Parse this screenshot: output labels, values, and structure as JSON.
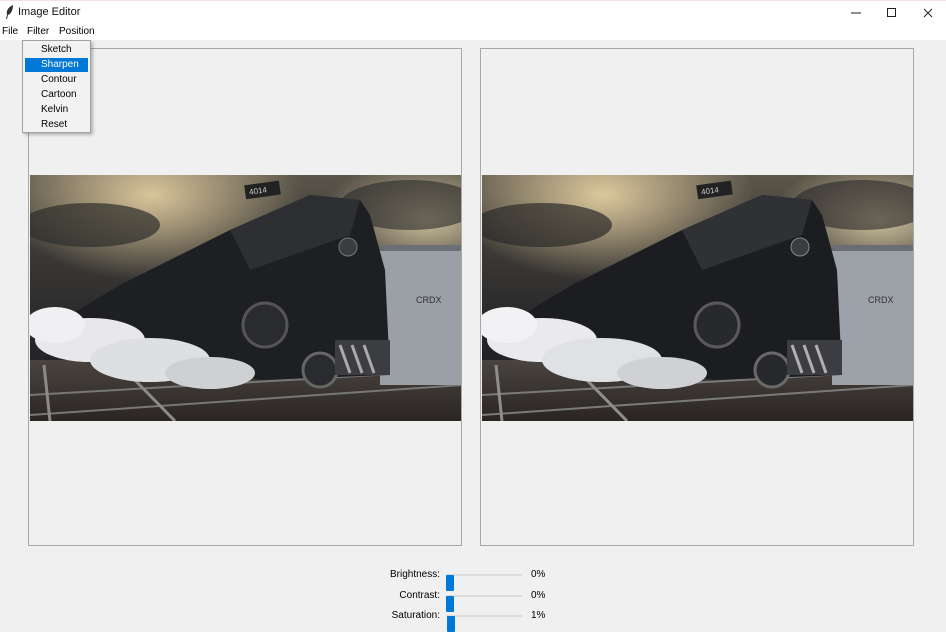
{
  "window": {
    "title": "Image Editor",
    "controls": {
      "minimize_icon": "minimize-icon",
      "maximize_icon": "maximize-icon",
      "close_icon": "close-icon"
    }
  },
  "menubar": {
    "items": [
      {
        "label": "File"
      },
      {
        "label": "Filter"
      },
      {
        "label": "Position"
      }
    ]
  },
  "filter_menu": {
    "items": [
      {
        "label": "Sketch"
      },
      {
        "label": "Sharpen",
        "selected": true
      },
      {
        "label": "Contour"
      },
      {
        "label": "Cartoon"
      },
      {
        "label": "Kelvin"
      },
      {
        "label": "Reset"
      }
    ]
  },
  "images": {
    "original_locomotive_number": "4014",
    "original_car_text": "CRDX",
    "edited_locomotive_number": "4014",
    "edited_car_text": "CRDX"
  },
  "sliders": [
    {
      "label": "Brightness:",
      "value_text": "0%",
      "value": 0
    },
    {
      "label": "Contrast:",
      "value_text": "0%",
      "value": 0
    },
    {
      "label": "Saturation:",
      "value_text": "1%",
      "value": 1
    }
  ],
  "colors": {
    "accent": "#0078d7",
    "window_bg": "#f0f0f0",
    "menu_bg": "#ffffff"
  }
}
